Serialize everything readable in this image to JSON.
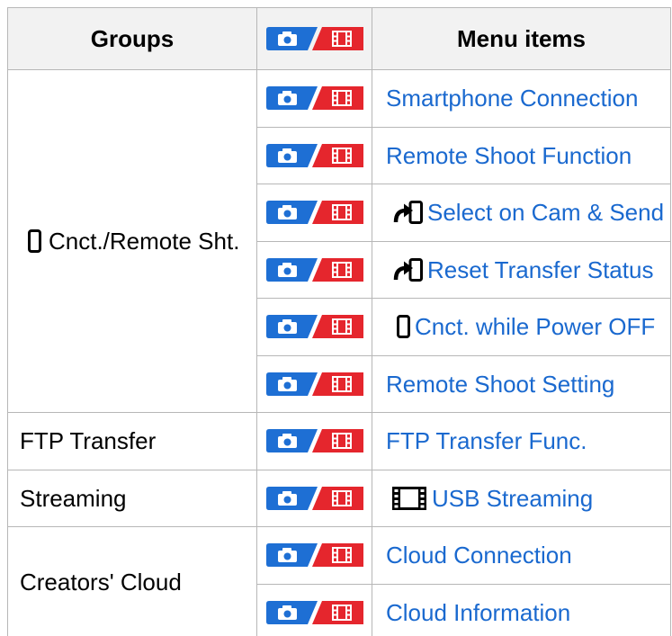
{
  "table": {
    "header": {
      "groups": "Groups",
      "mode_icon": "photo-movie-icon",
      "menu_items": "Menu items"
    },
    "groups": [
      {
        "label": "Cnct./Remote Sht.",
        "icon": "smartphone-icon",
        "items": [
          {
            "label": "Smartphone Connection",
            "mode_icon": "photo-movie-icon"
          },
          {
            "label": "Remote Shoot Function",
            "mode_icon": "photo-movie-icon"
          },
          {
            "label": "Select on Cam & Send",
            "icon": "transfer-icon",
            "mode_icon": "photo-movie-icon"
          },
          {
            "label": "Reset Transfer Status",
            "icon": "transfer-icon",
            "mode_icon": "photo-movie-icon"
          },
          {
            "label": "Cnct. while Power OFF",
            "icon": "smartphone-icon",
            "mode_icon": "photo-movie-icon"
          },
          {
            "label": "Remote Shoot Setting",
            "mode_icon": "photo-movie-icon"
          }
        ]
      },
      {
        "label": "FTP Transfer",
        "items": [
          {
            "label": "FTP Transfer Func.",
            "mode_icon": "photo-movie-icon"
          }
        ]
      },
      {
        "label": "Streaming",
        "items": [
          {
            "label": "USB Streaming",
            "icon": "movie-icon",
            "mode_icon": "photo-movie-icon"
          }
        ]
      },
      {
        "label": "Creators' Cloud",
        "items": [
          {
            "label": "Cloud Connection",
            "mode_icon": "photo-movie-icon"
          },
          {
            "label": "Cloud Information",
            "mode_icon": "photo-movie-icon"
          }
        ]
      }
    ]
  },
  "theme": {
    "link": "#1a69cf",
    "photo_mode": "#1e6fd4",
    "movie_mode": "#e5262d",
    "header_bg": "#f2f2f2",
    "border": "#b7b7b7"
  }
}
